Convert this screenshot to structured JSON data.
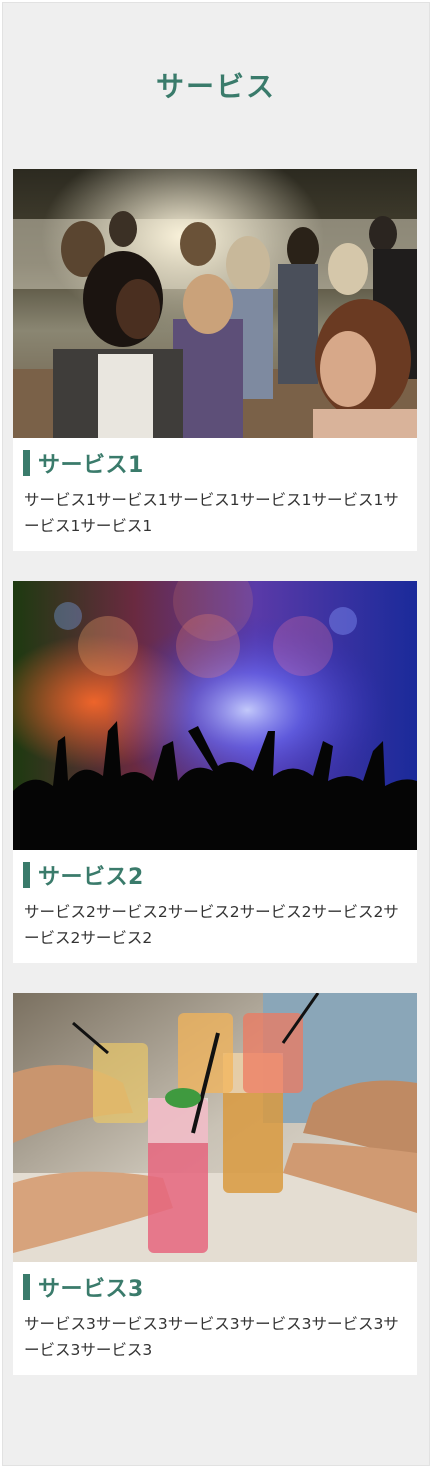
{
  "section": {
    "title": "サービス"
  },
  "services": [
    {
      "heading": "サービス1",
      "description": "サービス1サービス1サービス1サービス1サービス1サービス1サービス1",
      "image": "people-dancing-outdoors-photo"
    },
    {
      "heading": "サービス2",
      "description": "サービス2サービス2サービス2サービス2サービス2サービス2サービス2",
      "image": "concert-crowd-silhouette-photo"
    },
    {
      "heading": "サービス3",
      "description": "サービス3サービス3サービス3サービス3サービス3サービス3サービス3",
      "image": "cocktail-toast-photo"
    }
  ],
  "colors": {
    "accent": "#3a7b6b",
    "background": "#efefef",
    "card": "#ffffff",
    "text": "#333333"
  }
}
